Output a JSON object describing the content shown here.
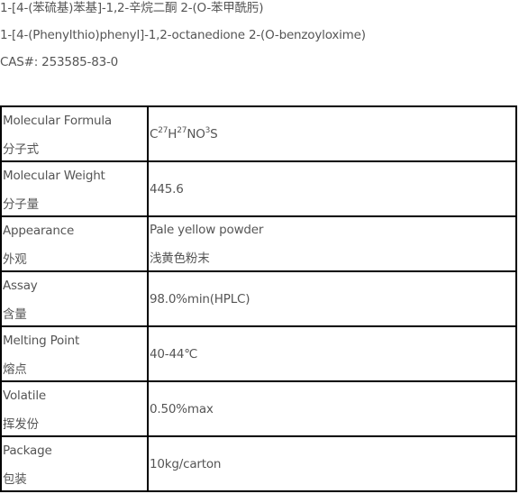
{
  "header": {
    "title_cn": "1-[4-(苯硫基)苯基]-1,2-辛烷二酮 2-(O-苯甲酰肟)",
    "title_en": "1-[4-(Phenylthio)phenyl]-1,2-octanedione 2-(O-benzoyloxime)",
    "cas": "CAS#: 253585-83-0"
  },
  "spec_table": {
    "rows": [
      {
        "label_en": "Molecular Formula",
        "label_cn": "分子式",
        "formula": [
          {
            "t": "C",
            "sup": "27"
          },
          {
            "t": "H",
            "sup": "27"
          },
          {
            "t": "NO",
            "sup": "3"
          },
          {
            "t": "S",
            "sup": ""
          }
        ]
      },
      {
        "label_en": "Molecular Weight",
        "label_cn": "分子量",
        "value": "445.6"
      },
      {
        "label_en": "Appearance",
        "label_cn": "外观",
        "value": "Pale yellow powder",
        "value_cn": "浅黄色粉末"
      },
      {
        "label_en": "Assay",
        "label_cn": "含量",
        "value": "98.0%min(HPLC)"
      },
      {
        "label_en": "Melting Point",
        "label_cn": "熔点",
        "value": "40-44℃"
      },
      {
        "label_en": "Volatile",
        "label_cn": "挥发份",
        "value": "0.50%max"
      },
      {
        "label_en": "Package",
        "label_cn": "包装",
        "value": "10kg/carton"
      }
    ]
  }
}
